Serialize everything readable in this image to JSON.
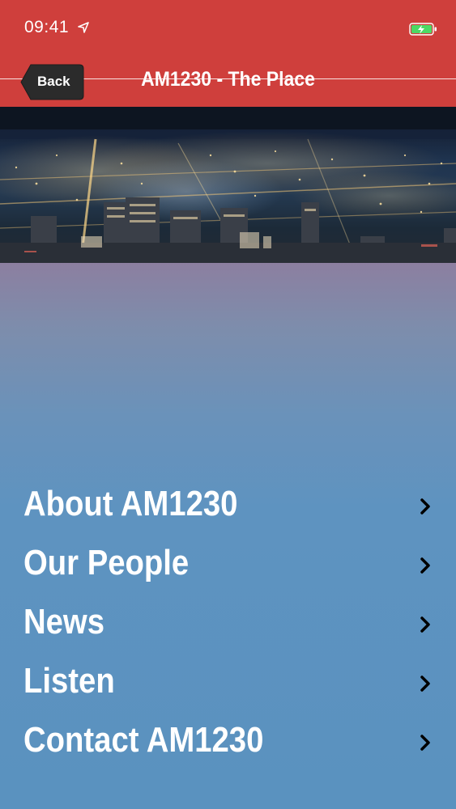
{
  "status_bar": {
    "time": "09:41",
    "location_icon": "location-arrow-icon",
    "battery_icon": "battery-charging-icon",
    "battery_color": "#4cd964"
  },
  "nav": {
    "back_label": "Back",
    "title": "AM1230 - The Place",
    "bar_color": "#cf3f3c"
  },
  "hero": {
    "image": "night-city-skyline"
  },
  "menu": {
    "items": [
      {
        "label": "About AM1230",
        "icon": "chevron-right-icon"
      },
      {
        "label": "Our People",
        "icon": "chevron-right-icon"
      },
      {
        "label": "News",
        "icon": "chevron-right-icon"
      },
      {
        "label": "Listen",
        "icon": "chevron-right-icon"
      },
      {
        "label": "Contact AM1230",
        "icon": "chevron-right-icon"
      }
    ]
  }
}
